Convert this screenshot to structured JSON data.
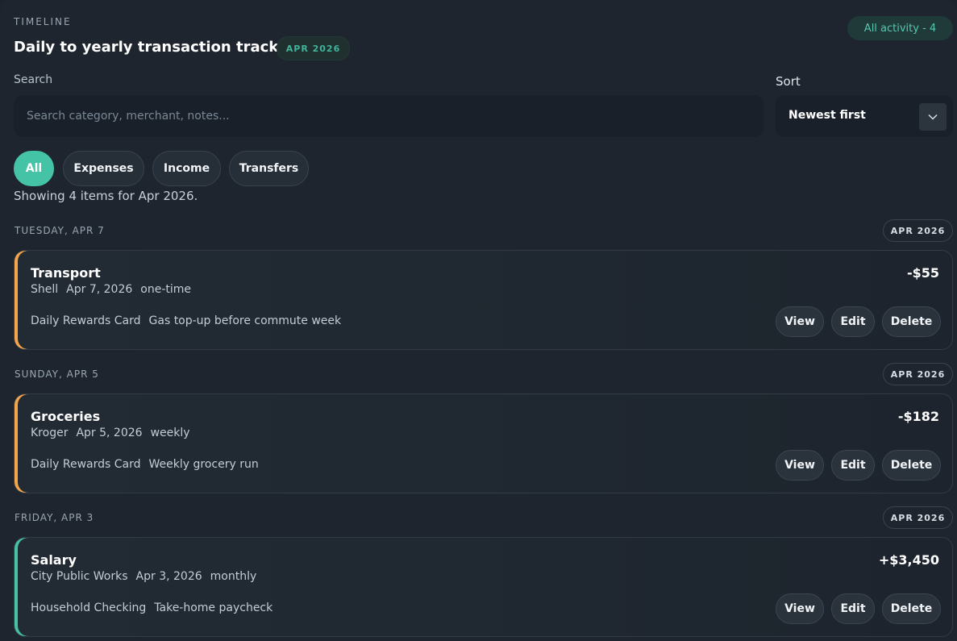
{
  "header": {
    "eyebrow": "TIMELINE",
    "title": "Daily to yearly transaction tracking",
    "period_badge": "APR 2026",
    "activity_pill": "All activity - 4"
  },
  "search": {
    "label": "Search",
    "placeholder": "Search category, merchant, notes...",
    "value": ""
  },
  "sort": {
    "label": "Sort",
    "selected": "Newest first"
  },
  "filters": [
    {
      "label": "All",
      "active": true
    },
    {
      "label": "Expenses",
      "active": false
    },
    {
      "label": "Income",
      "active": false
    },
    {
      "label": "Transfers",
      "active": false
    }
  ],
  "showing_text": "Showing 4 items for Apr 2026.",
  "groups": [
    {
      "day": "TUESDAY, APR 7",
      "badge": "APR 2026",
      "item": {
        "title": "Transport",
        "merchant": "Shell",
        "date": "Apr 7, 2026",
        "frequency": "one-time",
        "account": "Daily Rewards Card",
        "note": "Gas top-up before commute week",
        "amount": "-$55",
        "accent": "#f5a54a"
      }
    },
    {
      "day": "SUNDAY, APR 5",
      "badge": "APR 2026",
      "item": {
        "title": "Groceries",
        "merchant": "Kroger",
        "date": "Apr 5, 2026",
        "frequency": "weekly",
        "account": "Daily Rewards Card",
        "note": "Weekly grocery run",
        "amount": "-$182",
        "accent": "#f5a54a"
      }
    },
    {
      "day": "FRIDAY, APR 3",
      "badge": "APR 2026",
      "item": {
        "title": "Salary",
        "merchant": "City Public Works",
        "date": "Apr 3, 2026",
        "frequency": "monthly",
        "account": "Household Checking",
        "note": "Take-home paycheck",
        "amount": "+$3,450",
        "accent": "#45c3a6"
      }
    }
  ],
  "actions": {
    "view": "View",
    "edit": "Edit",
    "delete": "Delete"
  },
  "colors": {
    "accent_teal": "#45c3a6",
    "expense_orange": "#f5a54a",
    "background": "#1e252e"
  }
}
